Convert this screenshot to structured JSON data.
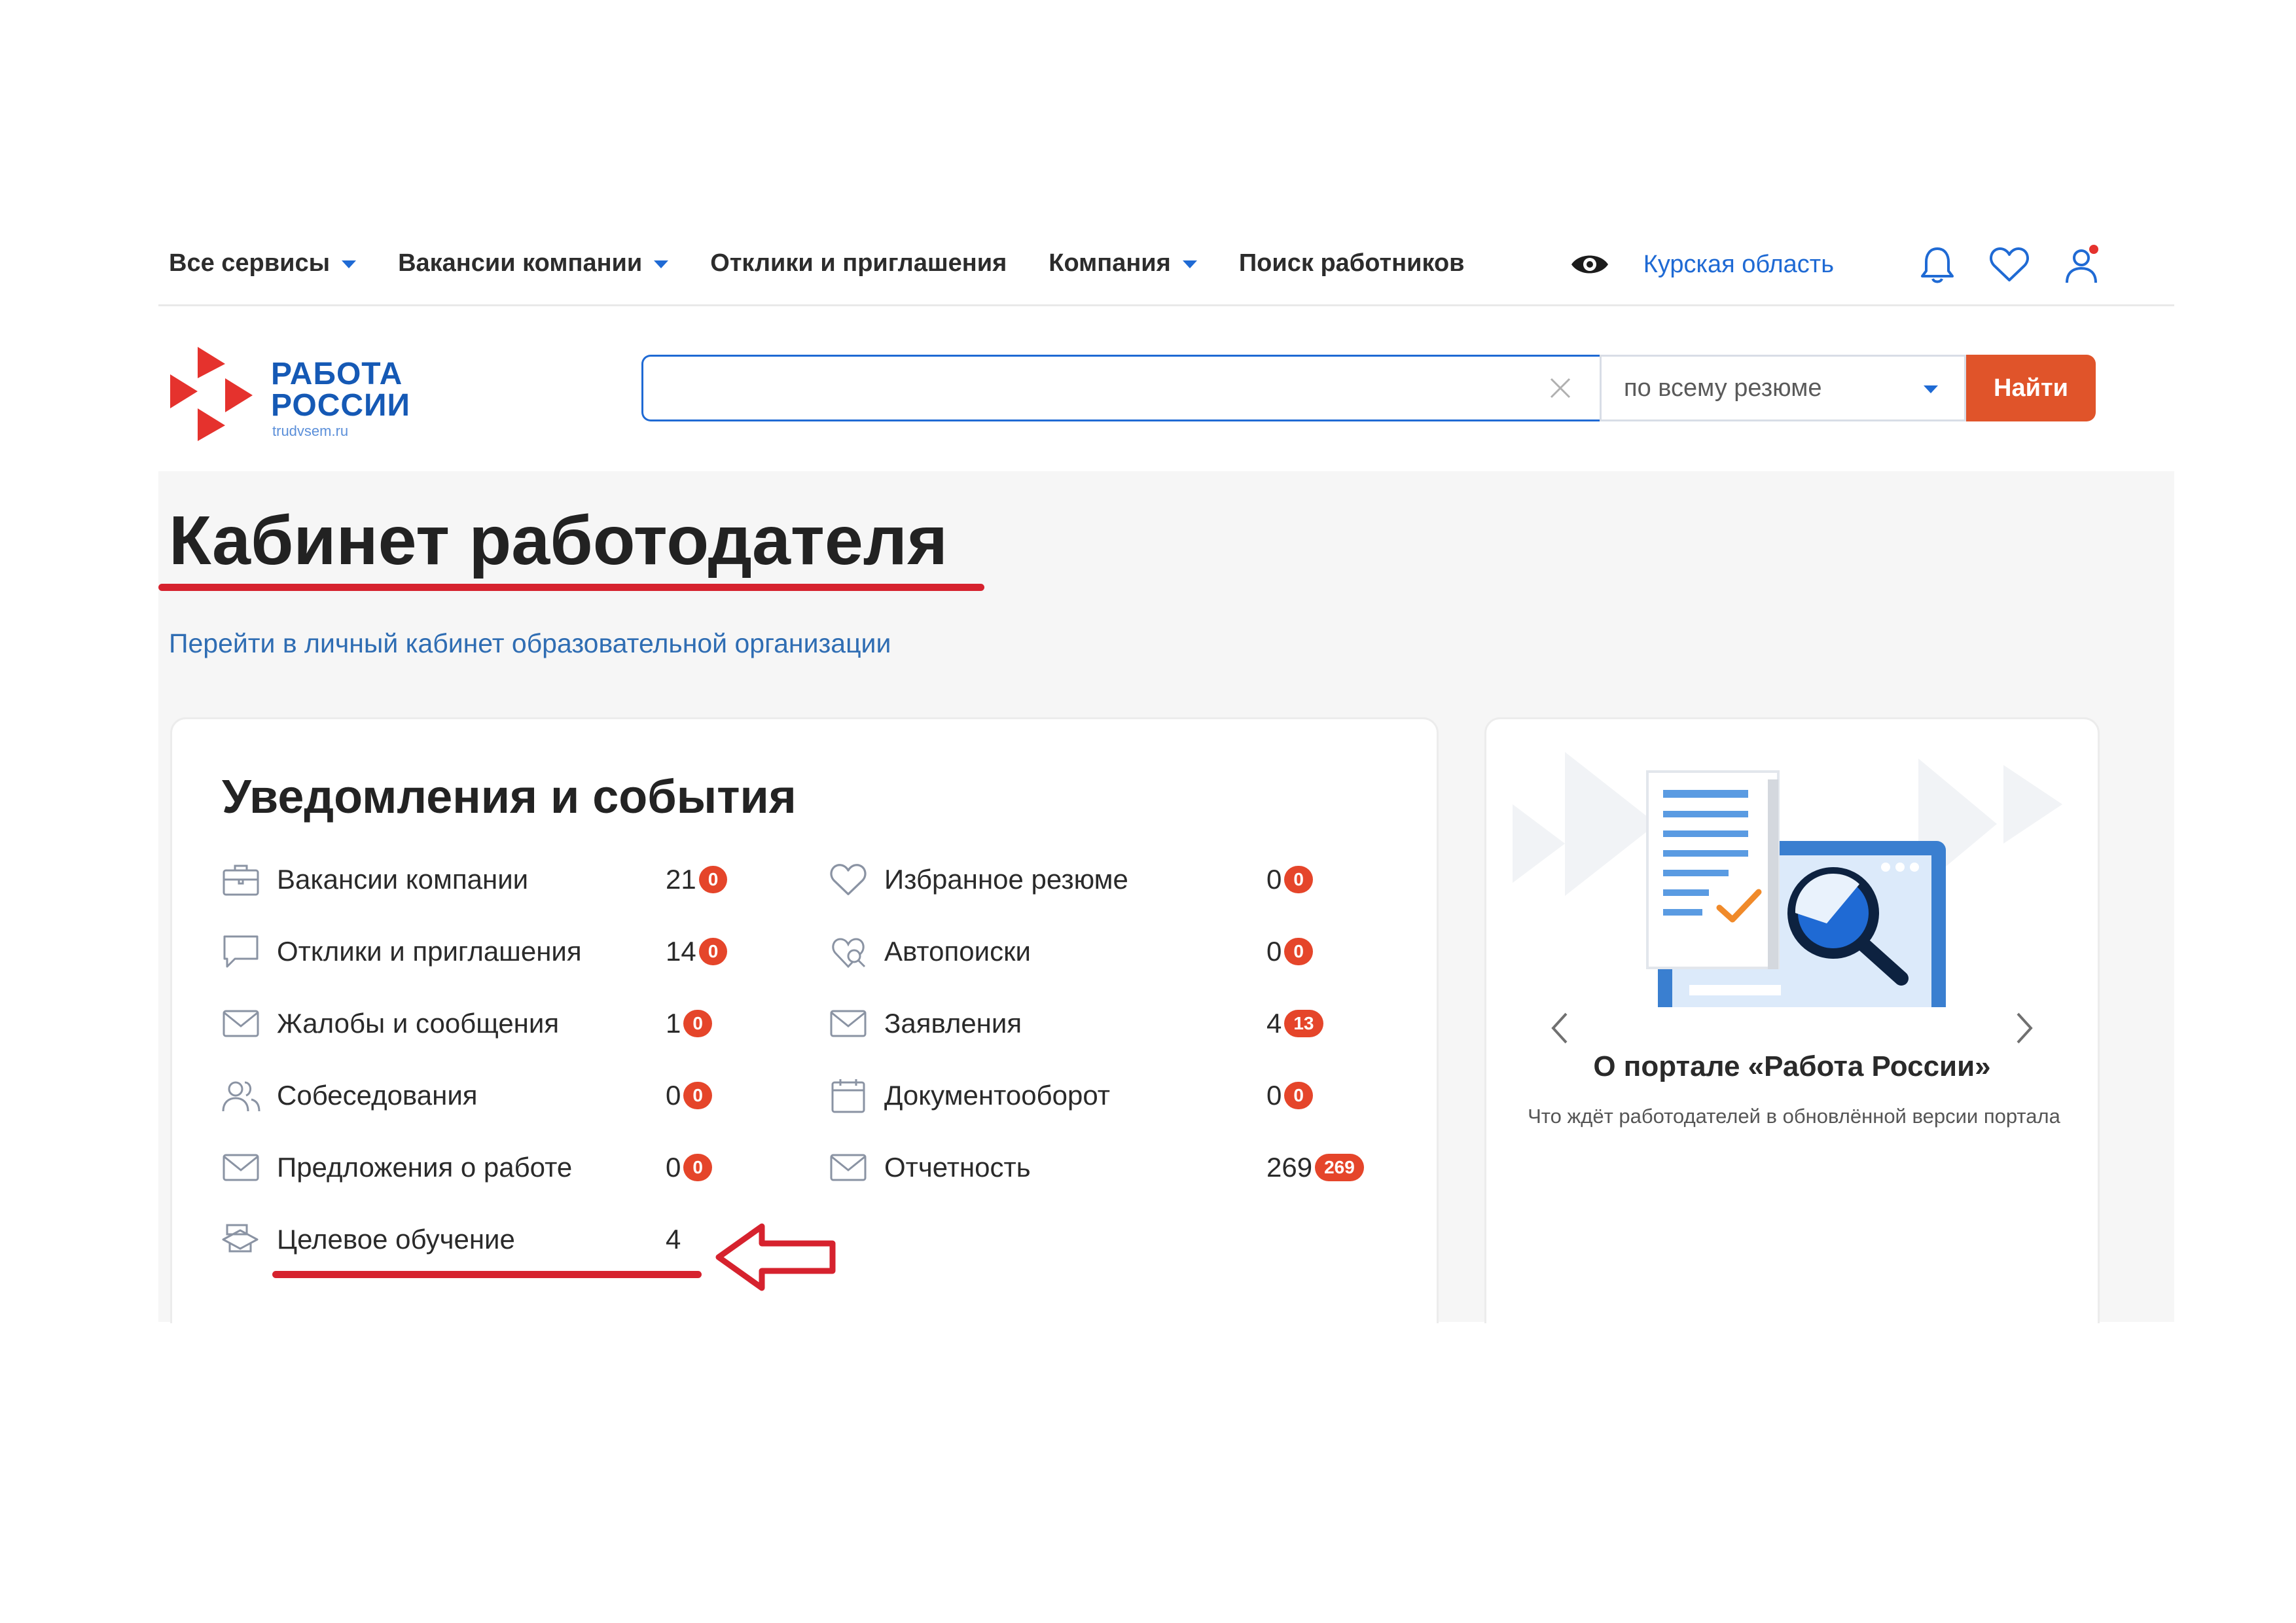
{
  "topnav": {
    "items": [
      {
        "label": "Все сервисы",
        "has_caret": true
      },
      {
        "label": "Вакансии компании",
        "has_caret": true
      },
      {
        "label": "Отклики и приглашения",
        "has_caret": false
      },
      {
        "label": "Компания",
        "has_caret": true
      },
      {
        "label": "Поиск работников",
        "has_caret": false
      }
    ],
    "region": "Курская область",
    "icons": [
      "eye-icon",
      "bell-icon",
      "heart-icon",
      "user-icon"
    ]
  },
  "logo": {
    "line1": "РАБОТА",
    "line2": "РОССИИ",
    "sub": "trudvsem.ru",
    "colors": {
      "arrow": "#e5322d",
      "text": "#1559b5"
    }
  },
  "search": {
    "value": "",
    "placeholder": "",
    "scope": "по всему резюме",
    "button": "Найти"
  },
  "main": {
    "title": "Кабинет работодателя",
    "edu_link": "Перейти в личный кабинет образовательной организации"
  },
  "notifications": {
    "title": "Уведомления и события",
    "left": [
      {
        "label": "Вакансии компании",
        "count": "21",
        "badge": "0",
        "icon": "briefcase-icon"
      },
      {
        "label": "Отклики и приглашения",
        "count": "14",
        "badge": "0",
        "icon": "chat-icon"
      },
      {
        "label": "Жалобы и сообщения",
        "count": "1",
        "badge": "0",
        "icon": "mail-icon"
      },
      {
        "label": "Собеседования",
        "count": "0",
        "badge": "0",
        "icon": "people-icon"
      },
      {
        "label": "Предложения о работе",
        "count": "0",
        "badge": "0",
        "icon": "mail-icon"
      },
      {
        "label": "Целевое обучение",
        "count": "4",
        "badge": "",
        "icon": "graduation-icon"
      }
    ],
    "right": [
      {
        "label": "Избранное резюме",
        "count": "0",
        "badge": "0",
        "icon": "heart-icon"
      },
      {
        "label": "Автопоиски",
        "count": "0",
        "badge": "0",
        "icon": "autosearch-icon"
      },
      {
        "label": "Заявления",
        "count": "4",
        "badge": "13",
        "icon": "mail-icon"
      },
      {
        "label": "Документооборот",
        "count": "0",
        "badge": "0",
        "icon": "calendar-icon"
      },
      {
        "label": "Отчетность",
        "count": "269",
        "badge": "269",
        "icon": "mail-icon"
      }
    ]
  },
  "promo": {
    "title": "О портале «Работа России»",
    "subtitle": "Что ждёт работодателей в обновлённой версии портала"
  },
  "colors": {
    "accent": "#1f6ad4",
    "button": "#e0542a",
    "badge": "#e5452a",
    "highlight": "#d6222e"
  }
}
